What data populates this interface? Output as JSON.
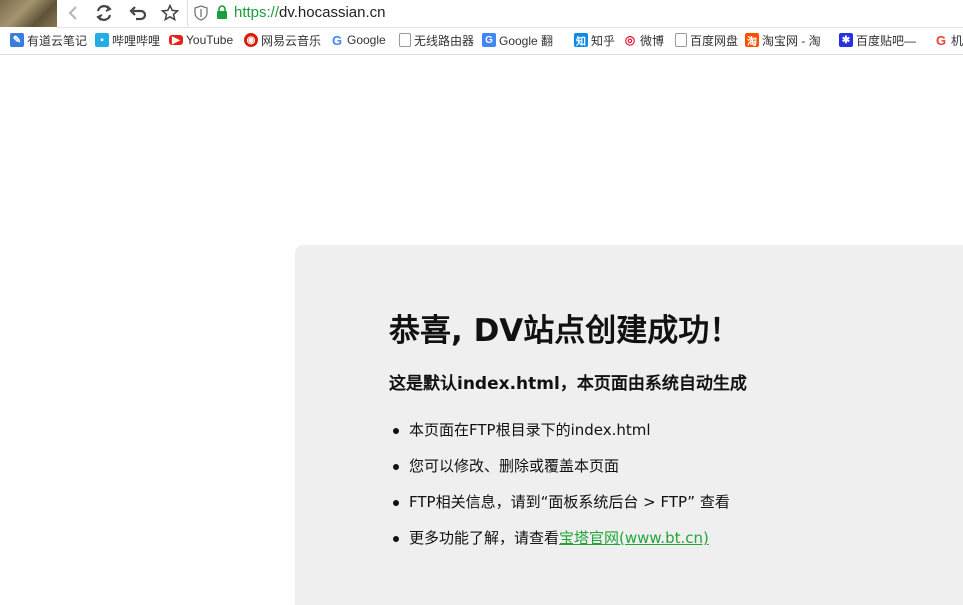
{
  "browser": {
    "url_scheme": "https://",
    "url_host": "dv.hocassian.cn"
  },
  "bookmarks": [
    {
      "label": "有道云笔记",
      "icon": "youdao-note-icon",
      "color": "#3b7ddd"
    },
    {
      "label": "哔哩哔哩",
      "icon": "bilibili-icon",
      "color": "#23ade5"
    },
    {
      "label": "YouTube",
      "icon": "youtube-icon",
      "color": "#e62117"
    },
    {
      "label": "网易云音乐",
      "icon": "netease-music-icon",
      "color": "#d81e06"
    },
    {
      "label": "Google",
      "icon": "google-icon",
      "color": "#4285f4"
    },
    {
      "label": "无线路由器",
      "icon": "page-icon",
      "color": "#888888"
    },
    {
      "label": "Google 翻",
      "icon": "google-translate-icon",
      "color": "#4285f4"
    },
    {
      "label": "知乎",
      "icon": "zhihu-icon",
      "color": "#0f88eb"
    },
    {
      "label": "微博",
      "icon": "weibo-icon",
      "color": "#e6162d"
    },
    {
      "label": "百度网盘",
      "icon": "page-icon",
      "color": "#888888"
    },
    {
      "label": "淘宝网 - 淘",
      "icon": "taobao-icon",
      "color": "#ff5000"
    },
    {
      "label": "百度贴吧—",
      "icon": "baidu-tieba-icon",
      "color": "#2932e1"
    },
    {
      "label": "机",
      "icon": "google-g-icon",
      "color": "#ea4335"
    }
  ],
  "page": {
    "title": "恭喜, DV站点创建成功！",
    "subtitle": "这是默认index.html，本页面由系统自动生成",
    "items": [
      "本页面在FTP根目录下的index.html",
      "您可以修改、删除或覆盖本页面",
      "FTP相关信息，请到“面板系统后台 > FTP” 查看"
    ],
    "last_item_prefix": "更多功能了解，请查看",
    "link_text": "宝塔官网(www.bt.cn)",
    "link_color": "#20a53a",
    "card_color": "#efefef"
  }
}
